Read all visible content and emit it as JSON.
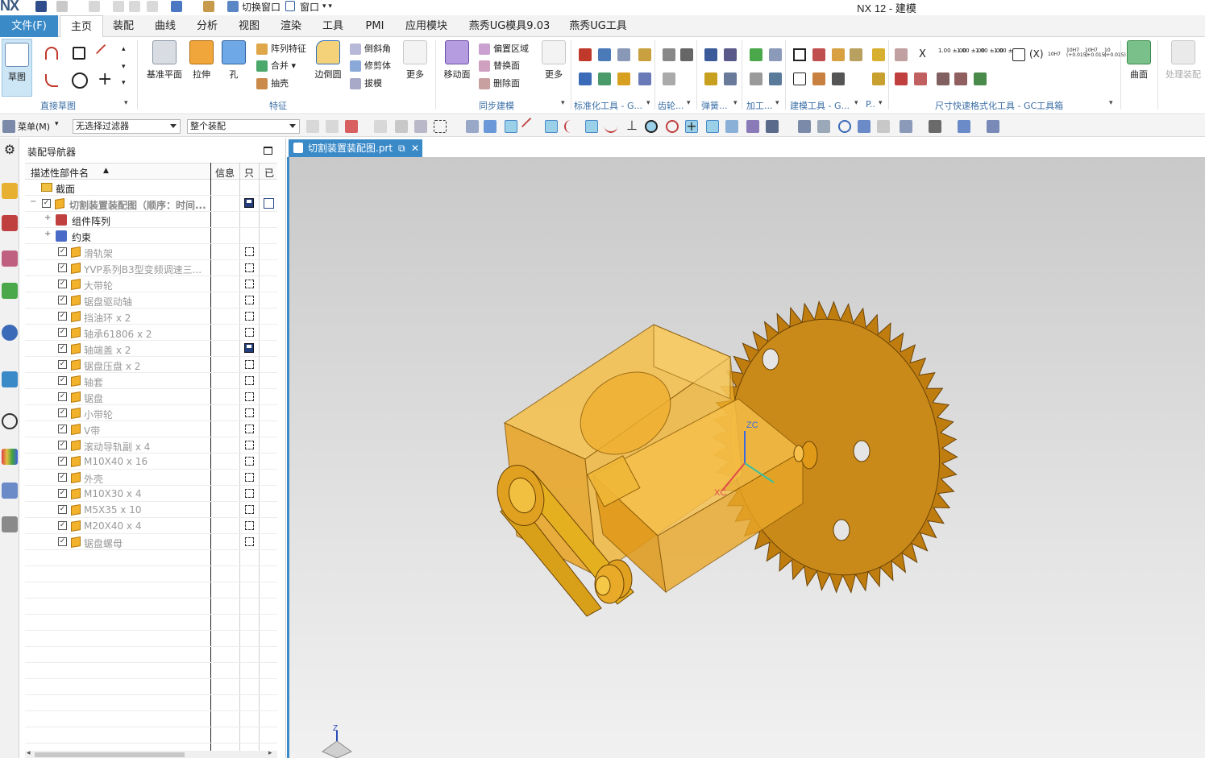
{
  "app": {
    "logo": "NX",
    "title": "NX 12 - 建模"
  },
  "quick_access": {
    "switch_window": "切换窗口",
    "window": "窗口"
  },
  "ribbon_tabs": [
    "文件(F)",
    "主页",
    "装配",
    "曲线",
    "分析",
    "视图",
    "渲染",
    "工具",
    "PMI",
    "应用模块",
    "燕秀UG模具9.03",
    "燕秀UG工具"
  ],
  "active_tab": "主页",
  "ribbon": {
    "sketch": "草图",
    "group_direct_sketch": "直接草图",
    "datum_plane": "基准平面",
    "extrude": "拉伸",
    "hole": "孔",
    "pattern_feature": "阵列特征",
    "unite": "合并",
    "shell": "抽壳",
    "edge_blend": "边倒圆",
    "chamfer": "倒斜角",
    "trim_body": "修剪体",
    "draft": "拔模",
    "more": "更多",
    "group_feature": "特征",
    "move_face": "移动面",
    "offset_region": "偏置区域",
    "replace_face": "替换面",
    "delete_face": "删除面",
    "group_sync": "同步建模",
    "group_std": "标准化工具 - G...",
    "group_gear": "齿轮...",
    "group_spring": "弹簧...",
    "group_machining": "加工...",
    "group_modeling_tools": "建模工具 - G...",
    "group_p": "P..",
    "group_dim": "尺寸快速格式化工具 - GC工具箱",
    "surface": "曲面",
    "process_assembly": "处理装配",
    "dim_labels": [
      "1.00 ±.00",
      "1.00 ±.00",
      "1.00 ±.00",
      "1.00 ±.00",
      "X",
      "(X)",
      "10H7",
      "10H7 (+0.015)",
      "10H7 (+0.015)",
      "10 (+0.015)"
    ]
  },
  "toolbar2": {
    "menu": "菜单(M)",
    "filter": "无选择过滤器",
    "scope": "整个装配"
  },
  "navigator": {
    "title": "装配导航器",
    "columns": {
      "name": "描述性部件名",
      "info": "信息",
      "only": "只",
      "modified": "已"
    },
    "rows": [
      {
        "label": "截面"
      },
      {
        "label": "切割装置装配图（顺序：时间..."
      },
      {
        "label": "组件阵列"
      },
      {
        "label": "约束"
      },
      {
        "label": "滑轨架"
      },
      {
        "label": "YVP系列B3型变频调速三..."
      },
      {
        "label": "大带轮"
      },
      {
        "label": "锯盘驱动轴"
      },
      {
        "label": "挡油环 x 2"
      },
      {
        "label": "轴承61806 x 2"
      },
      {
        "label": "轴端盖 x 2"
      },
      {
        "label": "锯盘压盘 x 2"
      },
      {
        "label": "轴套"
      },
      {
        "label": "锯盘"
      },
      {
        "label": "小带轮"
      },
      {
        "label": "V带"
      },
      {
        "label": "滚动导轨副 x 4"
      },
      {
        "label": "M10X40 x 16"
      },
      {
        "label": "外壳"
      },
      {
        "label": "M10X30 x 4"
      },
      {
        "label": "M5X35 x 10"
      },
      {
        "label": "M20X40 x 4"
      },
      {
        "label": "锯盘螺母"
      }
    ]
  },
  "document_tab": "切割装置装配图.prt",
  "axes": {
    "zc": "ZC",
    "xc": "XC",
    "z": "Z"
  },
  "colors": {
    "accent": "#3a8ac8",
    "model": "#f2b22b",
    "saw": "#c98a1a"
  }
}
